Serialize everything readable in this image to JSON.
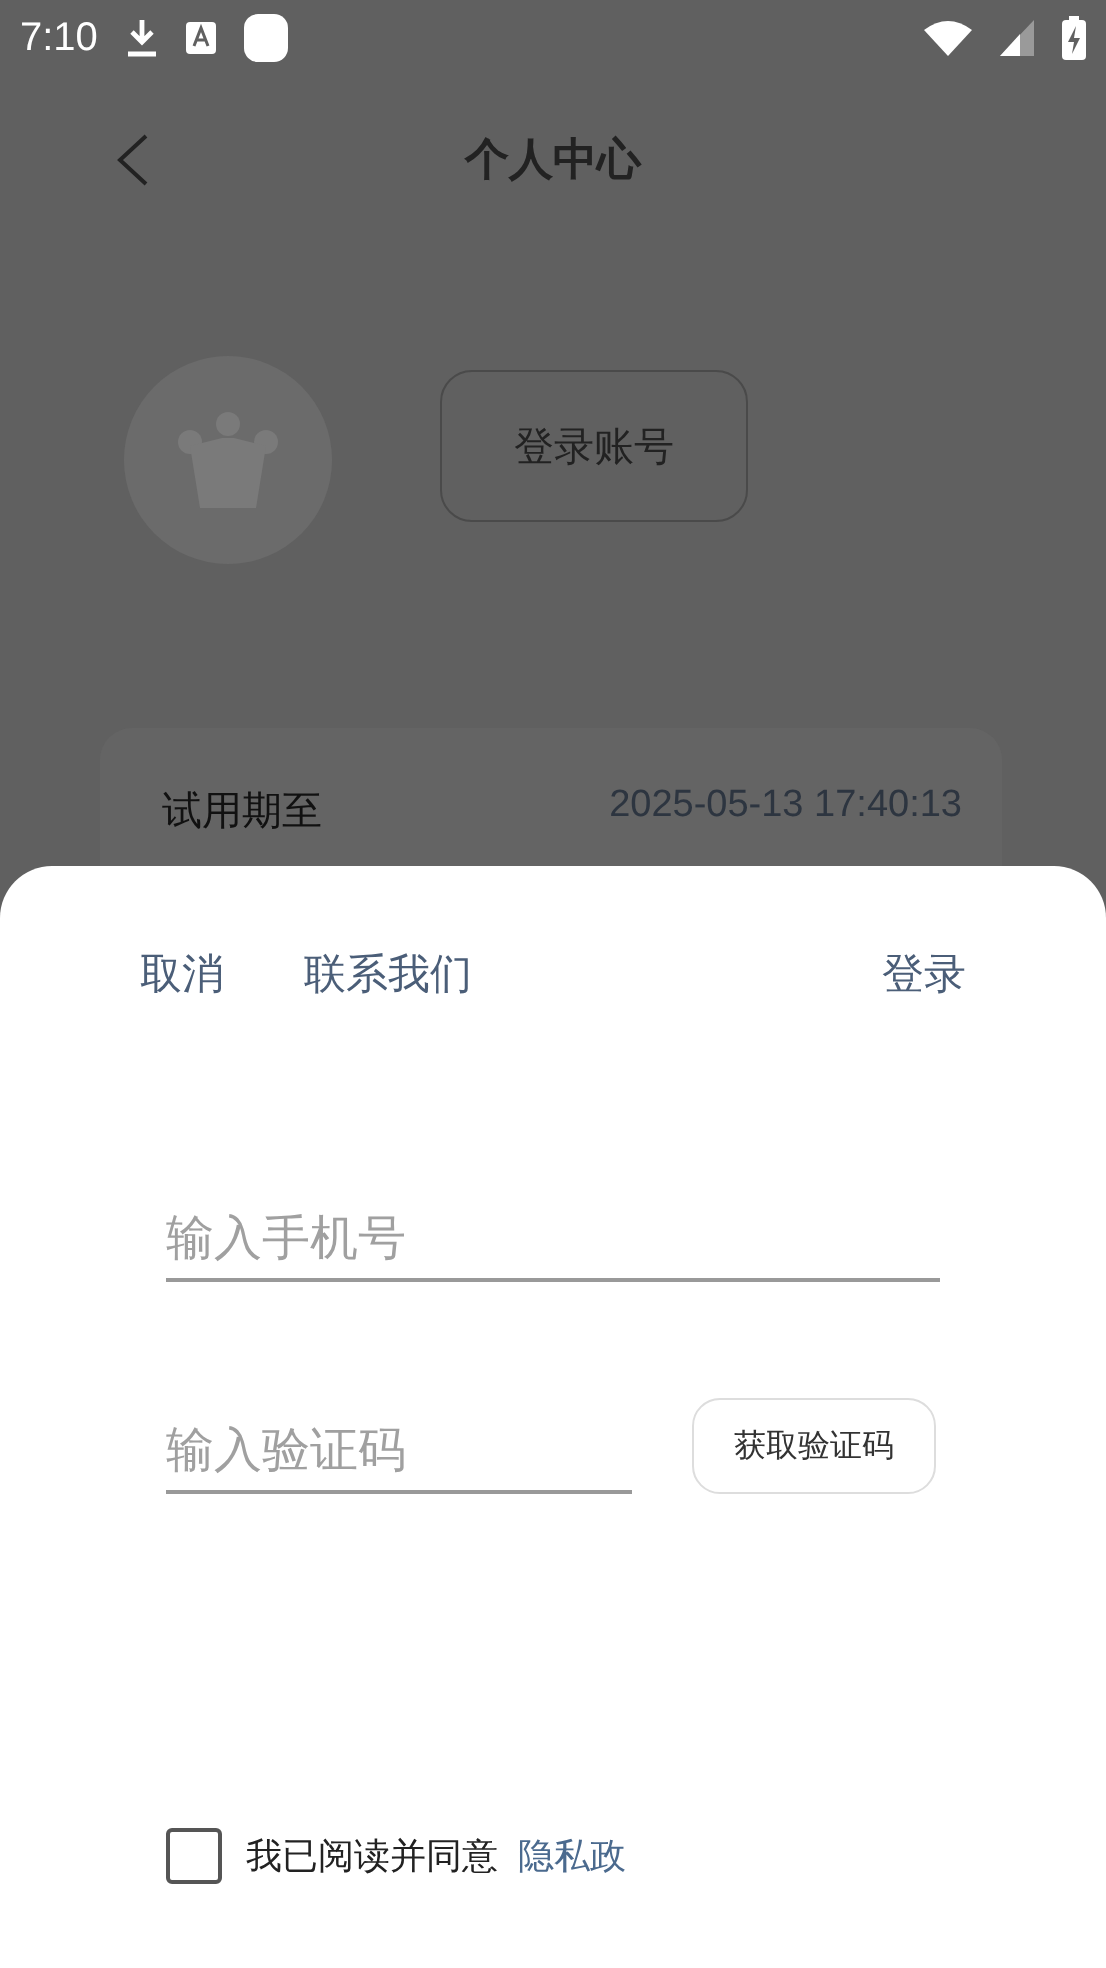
{
  "status_bar": {
    "time": "7:10"
  },
  "header": {
    "title": "个人中心"
  },
  "profile": {
    "login_button": "登录账号"
  },
  "trial": {
    "label": "试用期至",
    "value": "2025-05-13 17:40:13"
  },
  "sheet": {
    "left_actions": [
      "取消",
      "联系我们"
    ],
    "right_actions": [
      "登录"
    ],
    "phone_field": {
      "placeholder": "输入手机号"
    },
    "code_field": {
      "placeholder": "输入验证码"
    },
    "code_button": "获取验证码",
    "agreement": {
      "checked": false,
      "text": "我已阅读并同意",
      "link": "隐私政"
    }
  }
}
